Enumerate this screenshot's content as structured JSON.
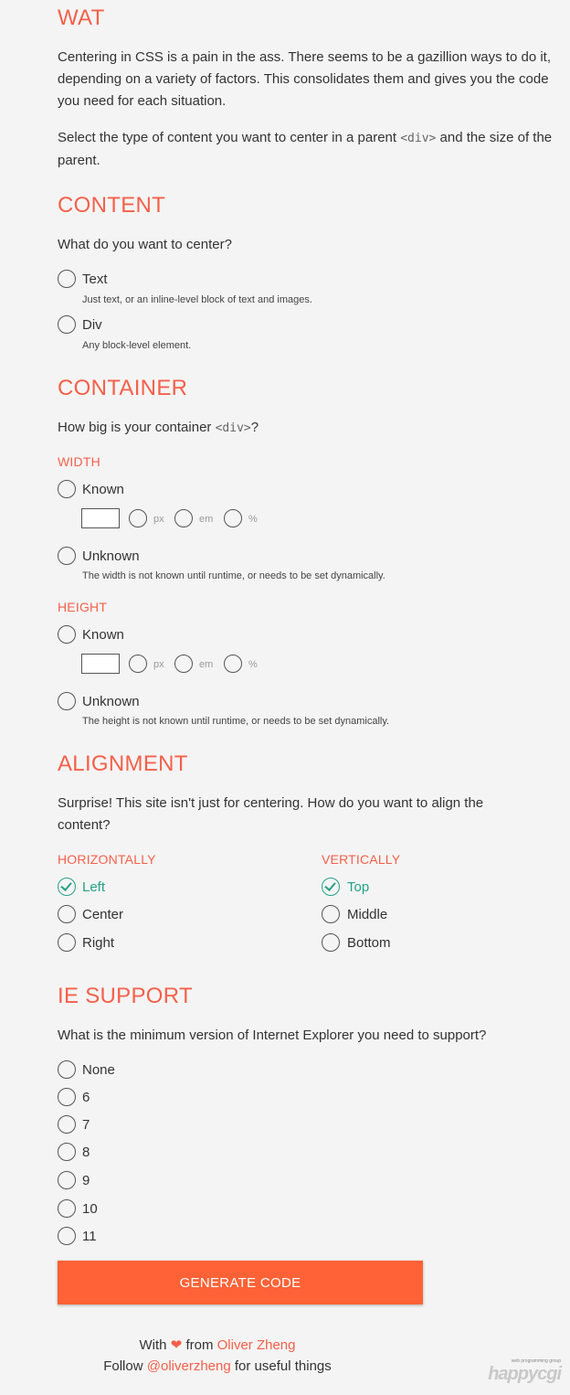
{
  "wat": {
    "title": "WAT",
    "p1": "Centering in CSS is a pain in the ass. There seems to be a gazillion ways to do it, depending on a variety of factors. This consolidates them and gives you the code you need for each situation.",
    "p2_before": "Select the type of content you want to center in a parent ",
    "p2_code": "<div>",
    "p2_after": " and the size of the parent."
  },
  "content": {
    "title": "CONTENT",
    "question": "What do you want to center?",
    "options": [
      {
        "label": "Text",
        "desc": "Just text, or an inline-level block of text and images."
      },
      {
        "label": "Div",
        "desc": "Any block-level element."
      }
    ]
  },
  "container": {
    "title": "CONTAINER",
    "question_before": "How big is your container ",
    "question_code": "<div>",
    "question_after": "?",
    "width": {
      "title": "WIDTH",
      "known": "Known",
      "units": [
        "px",
        "em",
        "%"
      ],
      "unknown": "Unknown",
      "unknown_desc": "The width is not known until runtime, or needs to be set dynamically."
    },
    "height": {
      "title": "HEIGHT",
      "known": "Known",
      "units": [
        "px",
        "em",
        "%"
      ],
      "unknown": "Unknown",
      "unknown_desc": "The height is not known until runtime, or needs to be set dynamically."
    }
  },
  "alignment": {
    "title": "ALIGNMENT",
    "question": "Surprise! This site isn't just for centering. How do you want to align the content?",
    "horizontal": {
      "title": "HORIZONTALLY",
      "options": [
        "Left",
        "Center",
        "Right"
      ],
      "selected": "Left"
    },
    "vertical": {
      "title": "VERTICALLY",
      "options": [
        "Top",
        "Middle",
        "Bottom"
      ],
      "selected": "Top"
    }
  },
  "ie": {
    "title": "IE SUPPORT",
    "question": "What is the minimum version of Internet Explorer you need to support?",
    "options": [
      "None",
      "6",
      "7",
      "8",
      "9",
      "10",
      "11"
    ]
  },
  "button": {
    "label": "GENERATE CODE"
  },
  "footer": {
    "with": "With",
    "from": "from",
    "author": "Oliver Zheng",
    "follow": "Follow",
    "handle": "@oliverzheng",
    "tail": "for useful things"
  },
  "watermark": {
    "small": "web programming group",
    "big": "happycgi"
  },
  "colors": {
    "accent": "#f5604a",
    "button": "#ff6236",
    "checked": "#26a087",
    "background": "#f4f4f4"
  }
}
